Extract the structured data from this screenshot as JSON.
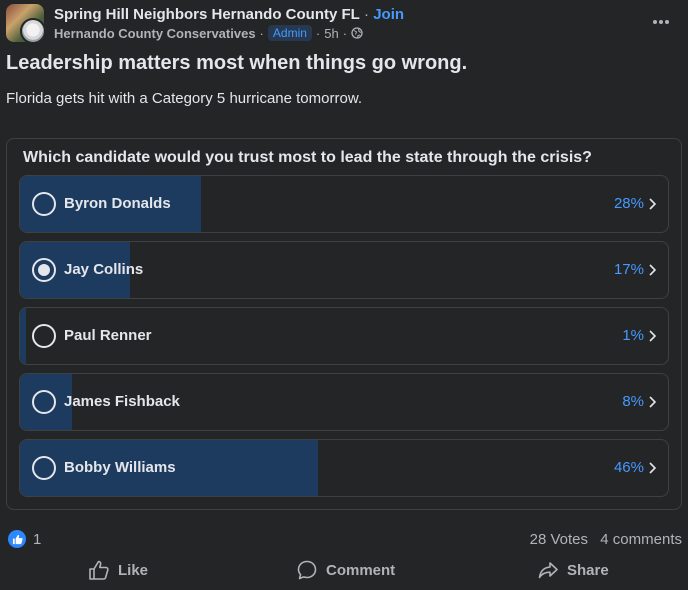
{
  "header": {
    "group_name": "Spring Hill Neighbors Hernando County FL",
    "join_label": "Join",
    "author": "Hernando County Conservatives",
    "role_badge": "Admin",
    "time": "5h",
    "more_icon": "more-horizontal-icon",
    "privacy_icon": "globe-icon"
  },
  "post": {
    "headline": "Leadership matters most when things go wrong.",
    "body": "Florida gets hit with a Category 5 hurricane tomorrow."
  },
  "poll": {
    "question": "Which candidate would you trust most to lead the state through the crisis?",
    "options": [
      {
        "name": "Byron Donalds",
        "percent_label": "28%",
        "percent": 28,
        "selected": false
      },
      {
        "name": "Jay Collins",
        "percent_label": "17%",
        "percent": 17,
        "selected": true
      },
      {
        "name": "Paul Renner",
        "percent_label": "1%",
        "percent": 1,
        "selected": false
      },
      {
        "name": "James Fishback",
        "percent_label": "8%",
        "percent": 8,
        "selected": false
      },
      {
        "name": "Bobby Williams",
        "percent_label": "46%",
        "percent": 46,
        "selected": false
      }
    ],
    "bar_color": "#1d3a5f",
    "percent_color": "#4599ff"
  },
  "stats": {
    "reaction_icon": "thumbs-up-icon",
    "reaction_count": "1",
    "votes": "28 Votes",
    "comments": "4 comments"
  },
  "actions": {
    "like_label": "Like",
    "comment_label": "Comment",
    "share_label": "Share"
  }
}
